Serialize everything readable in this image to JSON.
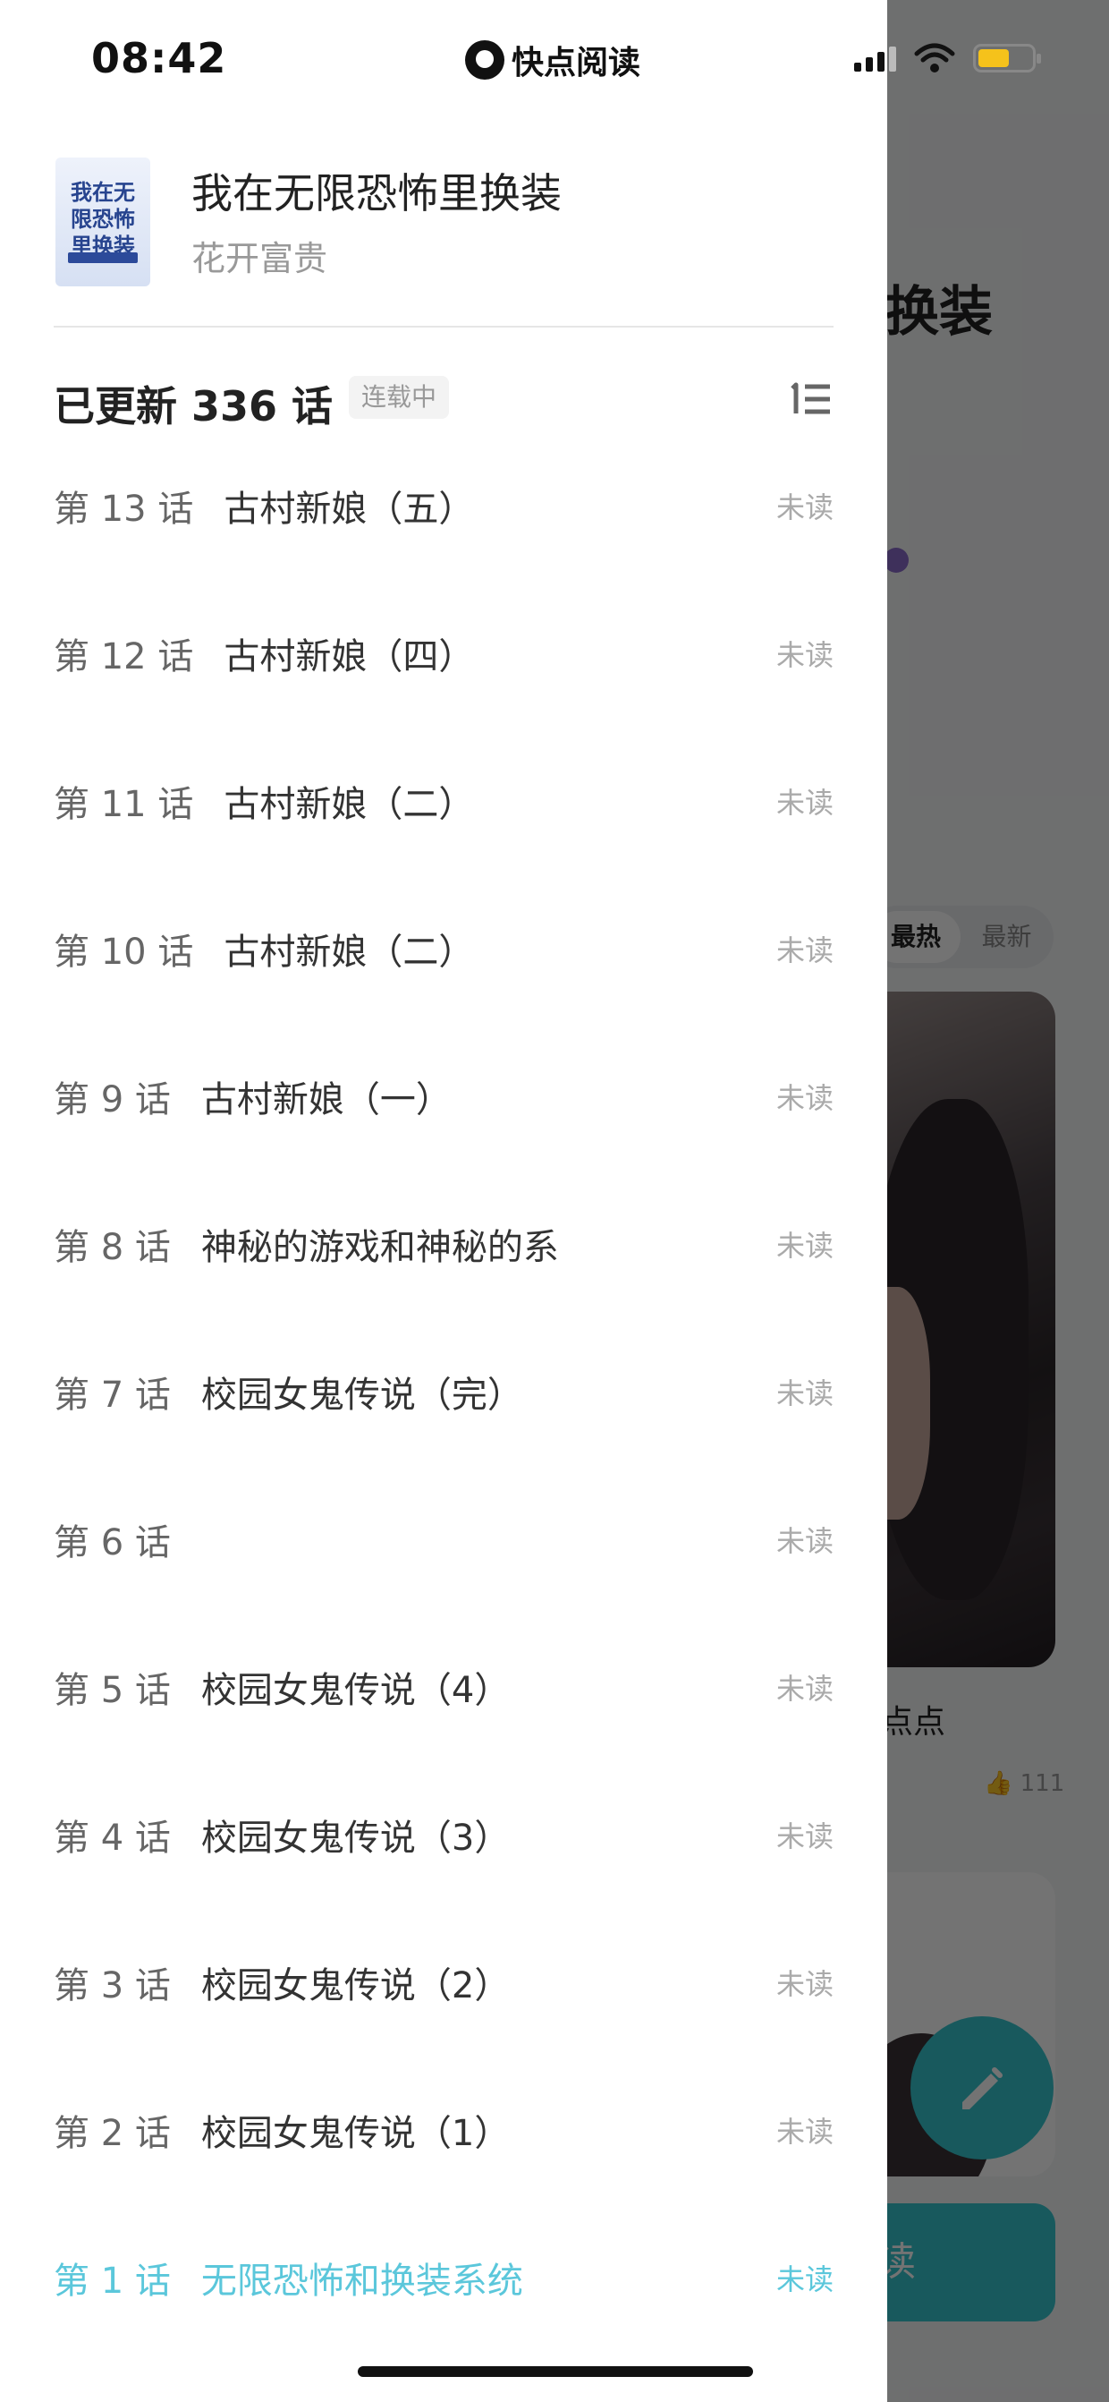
{
  "status_bar": {
    "time": "08:42",
    "app_name": "快点阅读"
  },
  "background": {
    "title_fragment": "换装",
    "tab_hot": "最热",
    "tab_new": "最新",
    "hint_fragment": "点点",
    "likes": "111",
    "read_button_fragment": "读",
    "accent_color": "#37c5cf"
  },
  "book": {
    "title": "我在无限恐怖里换装",
    "author": "花开富贵",
    "cover_text": "我在无限恐怖里换装"
  },
  "catalog": {
    "update_text": "已更新 336 话",
    "status_badge": "连载中",
    "chapters": [
      {
        "num": "第 13 话",
        "title": "古村新娘（五）",
        "status": "未读"
      },
      {
        "num": "第 12 话",
        "title": "古村新娘（四）",
        "status": "未读"
      },
      {
        "num": "第 11 话",
        "title": "古村新娘（二）",
        "status": "未读"
      },
      {
        "num": "第 10 话",
        "title": "古村新娘（二）",
        "status": "未读"
      },
      {
        "num": "第 9 话",
        "title": "古村新娘（一）",
        "status": "未读"
      },
      {
        "num": "第 8 话",
        "title": "神秘的游戏和神秘的系",
        "status": "未读"
      },
      {
        "num": "第 7 话",
        "title": "校园女鬼传说（完）",
        "status": "未读"
      },
      {
        "num": "第 6 话",
        "title": "",
        "status": "未读"
      },
      {
        "num": "第 5 话",
        "title": "校园女鬼传说（4）",
        "status": "未读"
      },
      {
        "num": "第 4 话",
        "title": "校园女鬼传说（3）",
        "status": "未读"
      },
      {
        "num": "第 3 话",
        "title": "校园女鬼传说（2）",
        "status": "未读"
      },
      {
        "num": "第 2 话",
        "title": "校园女鬼传说（1）",
        "status": "未读"
      },
      {
        "num": "第 1 话",
        "title": "无限恐怖和换装系统",
        "status": "未读"
      }
    ],
    "active_color": "#5bc7db"
  }
}
